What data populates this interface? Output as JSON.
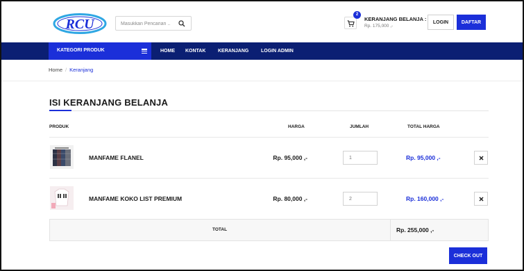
{
  "colors": {
    "accent": "#1b2fd9",
    "nav_bg": "#0b1f73"
  },
  "header": {
    "logo_icon": "rcu-logo",
    "search": {
      "placeholder": "Masukkan Pencarian ..",
      "icon": "search-icon"
    },
    "cart": {
      "badge_count": "2",
      "title": "KERANJANG BELANJA :",
      "total": "Rp. 175,000 ,-",
      "icon": "cart-icon"
    },
    "login_label": "LOGIN",
    "register_label": "DAFTAR"
  },
  "nav": {
    "category_label": "KATEGORI PRODUK",
    "links": [
      "HOME",
      "KONTAK",
      "KERANJANG",
      "LOGIN ADMIN"
    ]
  },
  "breadcrumb": {
    "home": "Home",
    "current": "Keranjang"
  },
  "main": {
    "title": "ISI KERANJANG BELANJA",
    "columns": {
      "product": "PRODUK",
      "price": "HARGA",
      "qty": "JUMLAH",
      "line_total": "TOTAL HARGA"
    },
    "items": [
      {
        "name": "MANFAME FLANEL",
        "price": "Rp. 95,000 ,-",
        "qty": "1",
        "line_total": "Rp. 95,000 ,-"
      },
      {
        "name": "MANFAME KOKO LIST PREMIUM",
        "price": "Rp. 80,000 ,-",
        "qty": "2",
        "line_total": "Rp. 160,000 ,-"
      }
    ],
    "total_label": "TOTAL",
    "total_value": "Rp. 255,000 ,-",
    "checkout_label": "CHECK OUT"
  }
}
